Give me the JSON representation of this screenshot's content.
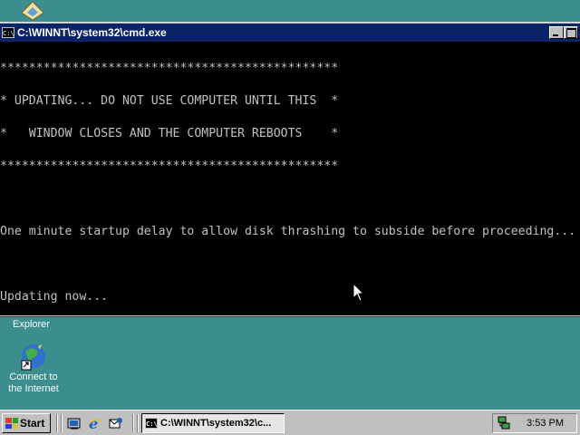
{
  "desktop": {
    "top_icon_label": "Explorer",
    "connect_icon_label": "Connect to\nthe Internet"
  },
  "window": {
    "title": "C:\\WINNT\\system32\\cmd.exe",
    "console_lines": [
      "***********************************************",
      "* UPDATING... DO NOT USE COMPUTER UNTIL THIS  *",
      "*   WINDOW CLOSES AND THE COMPUTER REBOOTS    *",
      "***********************************************",
      "",
      "One minute startup delay to allow disk thrashing to subside before proceeding...",
      "",
      "Updating now..."
    ],
    "colors": {
      "console_bg": "#000000",
      "console_text": "#c0c0c0",
      "titlebar": "#0a246a"
    }
  },
  "taskbar": {
    "start_label": "Start",
    "task_button_label": "C:\\WINNT\\system32\\c...",
    "clock": "3:53 PM",
    "quick_launch": [
      "show-desktop-icon",
      "internet-explorer-icon",
      "outlook-express-icon"
    ]
  }
}
